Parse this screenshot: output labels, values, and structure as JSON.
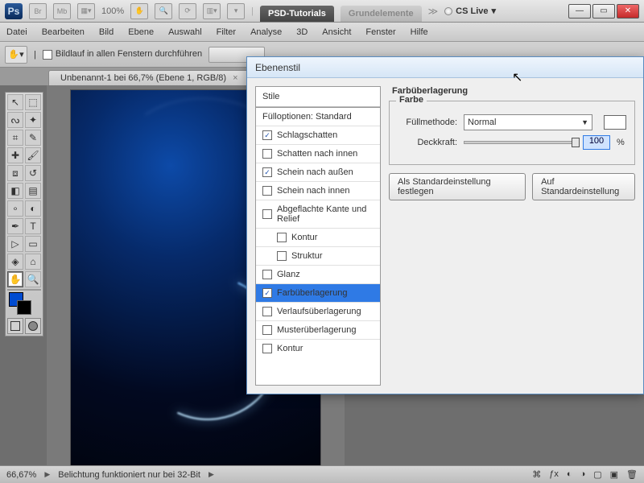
{
  "topbar": {
    "zoom": "100%",
    "tab_active": "PSD-Tutorials",
    "tab_inactive": "Grundelemente",
    "cslive": "CS Live"
  },
  "menu": {
    "items": [
      "Datei",
      "Bearbeiten",
      "Bild",
      "Ebene",
      "Auswahl",
      "Filter",
      "Analyse",
      "3D",
      "Ansicht",
      "Fenster",
      "Hilfe"
    ]
  },
  "optbar": {
    "scroll_all": "Bildlauf in allen Fenstern durchführen"
  },
  "doc": {
    "title": "Unbenannt-1 bei 66,7% (Ebene 1, RGB/8)"
  },
  "dialog": {
    "title": "Ebenenstil",
    "list_header": "Stile",
    "rows": [
      {
        "label": "Fülloptionen: Standard",
        "checkbox": false,
        "checked": false,
        "sub": false
      },
      {
        "label": "Schlagschatten",
        "checkbox": true,
        "checked": true,
        "sub": false
      },
      {
        "label": "Schatten nach innen",
        "checkbox": true,
        "checked": false,
        "sub": false
      },
      {
        "label": "Schein nach außen",
        "checkbox": true,
        "checked": true,
        "sub": false
      },
      {
        "label": "Schein nach innen",
        "checkbox": true,
        "checked": false,
        "sub": false
      },
      {
        "label": "Abgeflachte Kante und Relief",
        "checkbox": true,
        "checked": false,
        "sub": false
      },
      {
        "label": "Kontur",
        "checkbox": true,
        "checked": false,
        "sub": true
      },
      {
        "label": "Struktur",
        "checkbox": true,
        "checked": false,
        "sub": true
      },
      {
        "label": "Glanz",
        "checkbox": true,
        "checked": false,
        "sub": false
      },
      {
        "label": "Farbüberlagerung",
        "checkbox": true,
        "checked": true,
        "sub": false,
        "selected": true
      },
      {
        "label": "Verlaufsüberlagerung",
        "checkbox": true,
        "checked": false,
        "sub": false
      },
      {
        "label": "Musterüberlagerung",
        "checkbox": true,
        "checked": false,
        "sub": false
      },
      {
        "label": "Kontur",
        "checkbox": true,
        "checked": false,
        "sub": false
      }
    ],
    "section_title": "Farbüberlagerung",
    "group_title": "Farbe",
    "blend_label": "Füllmethode:",
    "blend_value": "Normal",
    "opacity_label": "Deckkraft:",
    "opacity_value": "100",
    "opacity_unit": "%",
    "btn_default": "Als Standardeinstellung festlegen",
    "btn_reset": "Auf Standardeinstellung"
  },
  "status": {
    "zoom": "66,67%",
    "msg": "Belichtung funktioniert nur bei 32-Bit"
  }
}
